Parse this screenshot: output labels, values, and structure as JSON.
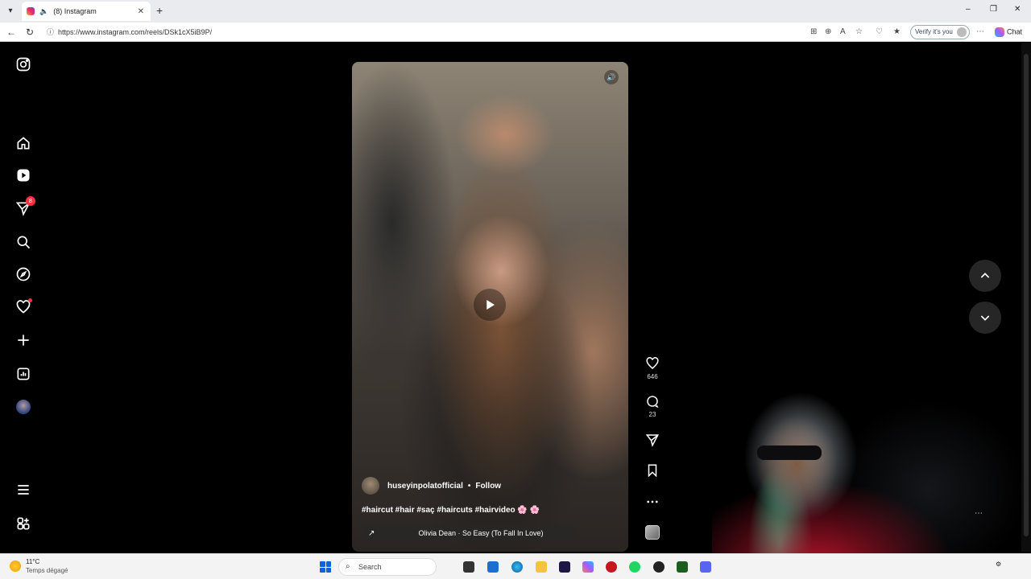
{
  "browser": {
    "tab_title": "(8) Instagram",
    "tab_close": "✕",
    "new_tab": "+",
    "url": "https://www.instagram.com/reels/DSk1cX5iB9P/",
    "verify_label": "Verify it's you",
    "chat_label": "Chat",
    "window_controls": [
      "–",
      "❐",
      "✕"
    ]
  },
  "sidebar": {
    "notifications_badge": "8",
    "items": [
      "Instagram",
      "Home",
      "Reels",
      "Messages",
      "Search",
      "Explore",
      "Notifications",
      "Create",
      "Dashboard",
      "Profile",
      "More",
      "Also from Meta"
    ]
  },
  "reel": {
    "author": "huseyinpolatofficial",
    "separator": "•",
    "follow_label": "Follow",
    "caption": "#haircut #hair #saç #haircuts #hairvideo 🌸 🌸",
    "audio": "Olivia Dean · So Easy (To Fall In Love)",
    "likes": "646",
    "comments": "23"
  },
  "taskbar": {
    "temperature": "11°C",
    "weather_desc": "Temps dégagé",
    "search_placeholder": "Search"
  },
  "colors": {
    "badge": "#ff3040",
    "page_bg": "#000000",
    "nav_button_bg": "#262626"
  }
}
